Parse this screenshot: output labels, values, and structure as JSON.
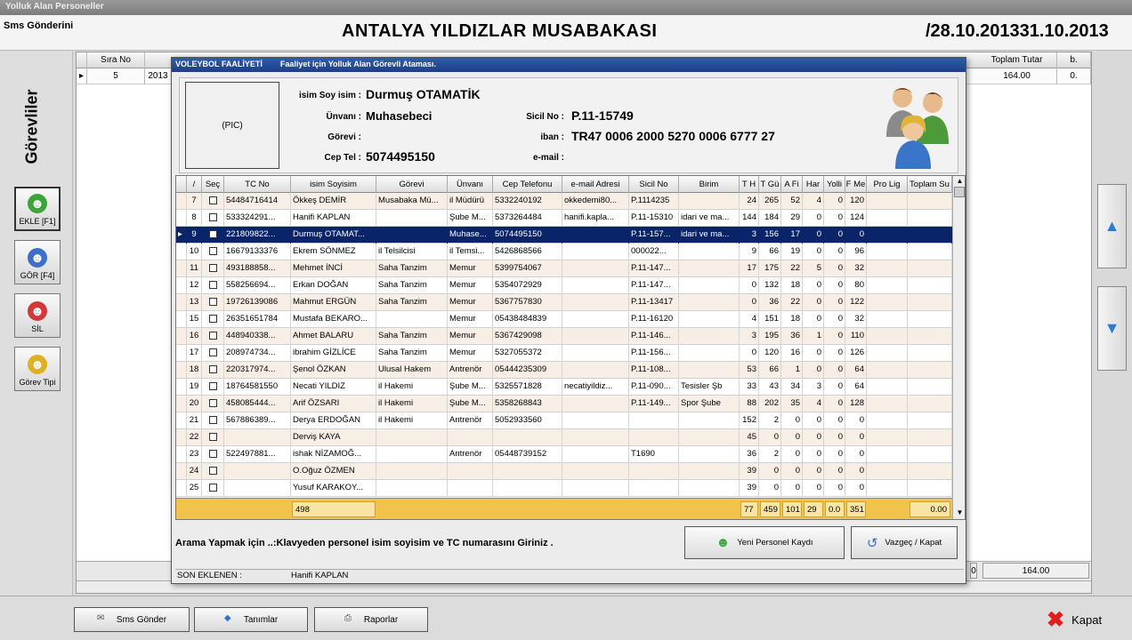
{
  "window": {
    "title": "Yolluk Alan Personeller"
  },
  "header": {
    "sms": "Sms Gönderini",
    "title": "ANTALYA YILDIZLAR MUSABAKASI",
    "dates": "/28.10.201331.10.2013"
  },
  "sidebar": {
    "label": "Görevliler",
    "buttons": [
      {
        "label": "EKLE [F1]",
        "icon": "add-person-icon"
      },
      {
        "label": "GÖR [F4]",
        "icon": "view-person-icon"
      },
      {
        "label": "SİL",
        "icon": "delete-person-icon"
      },
      {
        "label": "Görev Tipi",
        "icon": "task-type-icon"
      }
    ]
  },
  "background_grid": {
    "head": {
      "sira": "Sıra No",
      "toplam": "Toplam Tutar",
      "b": "b."
    },
    "row": {
      "sira": "5",
      "year": "2013",
      "toplam": "164.00",
      "b": "0."
    },
    "footer": {
      "left": "0",
      "total": "164.00"
    }
  },
  "bottom": {
    "sms": "Sms Gönder",
    "tanim": "Tanımlar",
    "rapor": "Raporlar",
    "kapat": "Kapat"
  },
  "modal": {
    "title_left": "VOLEYBOL FAALİYETİ",
    "title_right": "Faaliyet için Yolluk Alan Görevli Ataması.",
    "pic": "(PIC)",
    "labels": {
      "name": "isim Soy isim :",
      "unvan": "Ünvanı :",
      "gorev": "Görevi :",
      "tel": "Cep Tel :",
      "sicil": "Sicil No :",
      "iban": "iban :",
      "email": "e-mail :"
    },
    "values": {
      "name": "Durmuş OTAMATİK",
      "unvan": "Muhasebeci",
      "gorev": "",
      "tel": "5074495150",
      "sicil": "P.11-15749",
      "iban": "TR47 0006 2000 5270 0006 6777 27",
      "email": ""
    },
    "columns": [
      "",
      "/",
      "Seç",
      "TC No",
      "isim Soyisim",
      "Görevi",
      "Ünvanı",
      "Cep Telefonu",
      "e-mail Adresi",
      "Sicil No",
      "Birim",
      "T H",
      "T Gü",
      "A Fi",
      "Har",
      "Yolli",
      "F Me",
      "Pro Lig",
      "Toplam Su"
    ],
    "rows": [
      {
        "n": "7",
        "tc": "54484716414",
        "name": "Ökkeş DEMİR",
        "gorev": "Musabaka Mü...",
        "unvan": "il Müdürü",
        "tel": "5332240192",
        "email": "okkedemi80...",
        "sicil": "P.1114235",
        "birim": "",
        "th": "24",
        "tg": "265",
        "af": "52",
        "har": "4",
        "yol": "0",
        "fm": "120"
      },
      {
        "n": "8",
        "tc": "533324291...",
        "name": "Hanifi KAPLAN",
        "gorev": "",
        "unvan": "Şube M...",
        "tel": "5373264484",
        "email": "hanifi.kapla...",
        "sicil": "P.11-15310",
        "birim": "idari ve ma...",
        "th": "144",
        "tg": "184",
        "af": "29",
        "har": "0",
        "yol": "0",
        "fm": "124"
      },
      {
        "n": "9",
        "tc": "221809822...",
        "name": "Durmuş OTAMAT...",
        "gorev": "",
        "unvan": "Muhase...",
        "tel": "5074495150",
        "email": "",
        "sicil": "P.11-157...",
        "birim": "idari ve ma...",
        "th": "3",
        "tg": "156",
        "af": "17",
        "har": "0",
        "yol": "0",
        "fm": "0",
        "sel": true
      },
      {
        "n": "10",
        "tc": "16679133376",
        "name": "Ekrem SÖNMEZ",
        "gorev": "il Telsilcisi",
        "unvan": "il Temsi...",
        "tel": "5426868566",
        "email": "",
        "sicil": "000022...",
        "birim": "",
        "th": "9",
        "tg": "66",
        "af": "19",
        "har": "0",
        "yol": "0",
        "fm": "96"
      },
      {
        "n": "11",
        "tc": "493188858...",
        "name": "Mehmet İNCİ",
        "gorev": "Saha Tanzim",
        "unvan": "Memur",
        "tel": "5399754067",
        "email": "",
        "sicil": "P.11-147...",
        "birim": "",
        "th": "17",
        "tg": "175",
        "af": "22",
        "har": "5",
        "yol": "0",
        "fm": "32"
      },
      {
        "n": "12",
        "tc": "558256694...",
        "name": "Erkan DOĞAN",
        "gorev": "Saha Tanzim",
        "unvan": "Memur",
        "tel": "5354072929",
        "email": "",
        "sicil": "P.11-147...",
        "birim": "",
        "th": "0",
        "tg": "132",
        "af": "18",
        "har": "0",
        "yol": "0",
        "fm": "80"
      },
      {
        "n": "13",
        "tc": "19726139086",
        "name": "Mahmut ERGÜN",
        "gorev": "Saha Tanzim",
        "unvan": "Memur",
        "tel": "5367757830",
        "email": "",
        "sicil": "P.11-13417",
        "birim": "",
        "th": "0",
        "tg": "36",
        "af": "22",
        "har": "0",
        "yol": "0",
        "fm": "122"
      },
      {
        "n": "15",
        "tc": "26351651784",
        "name": "Mustafa BEKARO...",
        "gorev": "",
        "unvan": "Memur",
        "tel": "05438484839",
        "email": "",
        "sicil": "P.11-16120",
        "birim": "",
        "th": "4",
        "tg": "151",
        "af": "18",
        "har": "0",
        "yol": "0",
        "fm": "32"
      },
      {
        "n": "16",
        "tc": "448940338...",
        "name": "Ahmet BALARU",
        "gorev": "Saha Tanzim",
        "unvan": "Memur",
        "tel": "5367429098",
        "email": "",
        "sicil": "P.11-146...",
        "birim": "",
        "th": "3",
        "tg": "195",
        "af": "36",
        "har": "1",
        "yol": "0",
        "fm": "110"
      },
      {
        "n": "17",
        "tc": "208974734...",
        "name": "ibrahim GİZLİCE",
        "gorev": "Saha Tanzim",
        "unvan": "Memur",
        "tel": "5327055372",
        "email": "",
        "sicil": "P.11-156...",
        "birim": "",
        "th": "0",
        "tg": "120",
        "af": "16",
        "har": "0",
        "yol": "0",
        "fm": "126"
      },
      {
        "n": "18",
        "tc": "220317974...",
        "name": "Şenol ÖZKAN",
        "gorev": "Ulusal Hakem",
        "unvan": "Antrenör",
        "tel": "05444235309",
        "email": "",
        "sicil": "P.11-108...",
        "birim": "",
        "th": "53",
        "tg": "66",
        "af": "1",
        "har": "0",
        "yol": "0",
        "fm": "64"
      },
      {
        "n": "19",
        "tc": "18764581550",
        "name": "Necati YILDIZ",
        "gorev": "il Hakemi",
        "unvan": "Şube M...",
        "tel": "5325571828",
        "email": "necatiyildiz...",
        "sicil": "P.11-090...",
        "birim": "Tesisler Şb",
        "th": "33",
        "tg": "43",
        "af": "34",
        "har": "3",
        "yol": "0",
        "fm": "64"
      },
      {
        "n": "20",
        "tc": "458085444...",
        "name": "Arif ÖZSARI",
        "gorev": "il Hakemi",
        "unvan": "Şube M...",
        "tel": "5358268843",
        "email": "",
        "sicil": "P.11-149...",
        "birim": "Spor Şube",
        "th": "88",
        "tg": "202",
        "af": "35",
        "har": "4",
        "yol": "0",
        "fm": "128"
      },
      {
        "n": "21",
        "tc": "567886389...",
        "name": "Derya ERDOĞAN",
        "gorev": "il Hakemi",
        "unvan": "Antrenör",
        "tel": "5052933560",
        "email": "",
        "sicil": "",
        "birim": "",
        "th": "152",
        "tg": "2",
        "af": "0",
        "har": "0",
        "yol": "0",
        "fm": "0"
      },
      {
        "n": "22",
        "tc": "",
        "name": "Derviş KAYA",
        "gorev": "",
        "unvan": "",
        "tel": "",
        "email": "",
        "sicil": "",
        "birim": "",
        "th": "45",
        "tg": "0",
        "af": "0",
        "har": "0",
        "yol": "0",
        "fm": "0"
      },
      {
        "n": "23",
        "tc": "522497881...",
        "name": "ishak NİZAMOĞ...",
        "gorev": "",
        "unvan": "Antrenör",
        "tel": "05448739152",
        "email": "",
        "sicil": "T1690",
        "birim": "",
        "th": "36",
        "tg": "2",
        "af": "0",
        "har": "0",
        "yol": "0",
        "fm": "0"
      },
      {
        "n": "24",
        "tc": "",
        "name": "O.Oğuz ÖZMEN",
        "gorev": "",
        "unvan": "",
        "tel": "",
        "email": "",
        "sicil": "",
        "birim": "",
        "th": "39",
        "tg": "0",
        "af": "0",
        "har": "0",
        "yol": "0",
        "fm": "0"
      },
      {
        "n": "25",
        "tc": "",
        "name": "Yusuf KARAKOY...",
        "gorev": "",
        "unvan": "",
        "tel": "",
        "email": "",
        "sicil": "",
        "birim": "",
        "th": "39",
        "tg": "0",
        "af": "0",
        "har": "0",
        "yol": "0",
        "fm": "0"
      }
    ],
    "footer": {
      "count": "498",
      "th": "77",
      "tg": "459",
      "af": "101",
      "har": "29",
      "yol": "0.0",
      "fm": "351",
      "total": "0.00"
    },
    "search_hint": "Arama Yapmak için ..:Klavyeden personel isim soyisim ve TC numarasını Giriniz .",
    "new_button": "Yeni Personel Kaydı",
    "cancel_button": "Vazgeç / Kapat",
    "son_label": "SON EKLENEN :",
    "son_value": "Hanifi KAPLAN"
  }
}
